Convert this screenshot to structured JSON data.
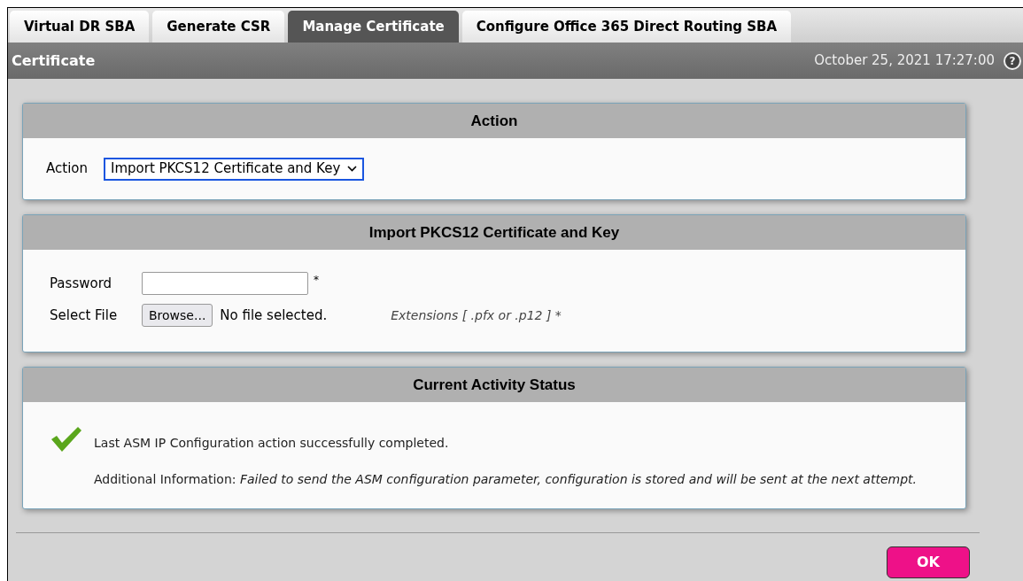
{
  "tabs": [
    {
      "label": "Virtual DR SBA",
      "selected": false
    },
    {
      "label": "Generate CSR",
      "selected": false
    },
    {
      "label": "Manage Certificate",
      "selected": true
    },
    {
      "label": "Configure Office 365 Direct Routing SBA",
      "selected": false
    }
  ],
  "header": {
    "title": "Certificate",
    "datetime": "October 25, 2021 17:27:00",
    "help_icon": "?"
  },
  "action_panel": {
    "title": "Action",
    "label": "Action",
    "value": "Import PKCS12 Certificate and Key"
  },
  "import_panel": {
    "title": "Import PKCS12 Certificate and Key",
    "password_label": "Password",
    "required_mark": "*",
    "file_label": "Select File",
    "browse_button": "Browse...",
    "file_status": "No file selected.",
    "extensions_note": "Extensions [ .pfx or .p12 ] *"
  },
  "status_panel": {
    "title": "Current Activity Status",
    "kind": "success",
    "message": "Last ASM IP Configuration action successfully completed.",
    "details": "Additional Information: *Failed to send the ASM configuration parameter, configuration is stored and will be sent at the next attempt.*"
  },
  "ok_button": "OK"
}
